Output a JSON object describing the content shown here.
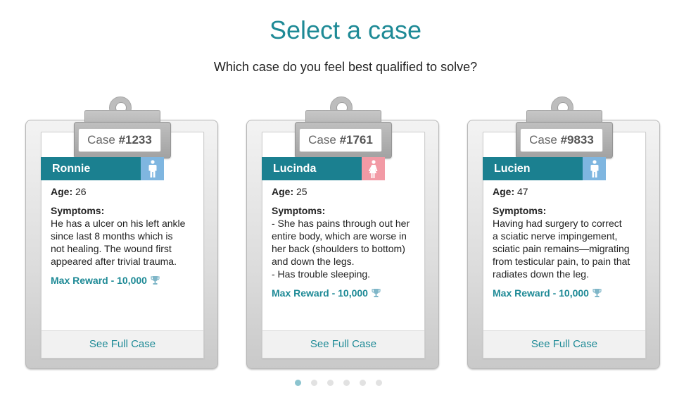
{
  "header": {
    "title": "Select a case",
    "subtitle": "Which case do you feel best qualified to solve?"
  },
  "cases": [
    {
      "case_prefix": "Case ",
      "case_number": "#1233",
      "name": "Ronnie",
      "gender": "male",
      "gender_icon": "male-person-icon",
      "age_label": "Age:",
      "age": "26",
      "symptoms_label": "Symptoms:",
      "symptom_lines": [
        "He has a ulcer on his left ankle",
        "since last 8 months which is",
        "not healing. The wound first",
        "appeared after trivial trauma."
      ],
      "reward": "Max Reward - 10,000",
      "reward_icon": "trophy-icon",
      "see_full": "See Full Case"
    },
    {
      "case_prefix": "Case ",
      "case_number": "#1761",
      "name": "Lucinda",
      "gender": "female",
      "gender_icon": "female-person-icon",
      "age_label": "Age:",
      "age": "25",
      "symptoms_label": "Symptoms:",
      "symptom_lines": [
        "- She has pains through out her",
        "entire body, which are worse in",
        "her back (shoulders to bottom)",
        "and down the legs.",
        "- Has trouble sleeping."
      ],
      "reward": "Max Reward - 10,000",
      "reward_icon": "trophy-icon",
      "see_full": "See Full Case"
    },
    {
      "case_prefix": "Case ",
      "case_number": "#9833",
      "name": "Lucien",
      "gender": "male",
      "gender_icon": "male-person-icon",
      "age_label": "Age:",
      "age": "47",
      "symptoms_label": "Symptoms:",
      "symptom_lines": [
        "Having had surgery to correct",
        "a sciatic nerve impingement,",
        "sciatic pain remains—migrating",
        "from testicular pain, to pain that",
        "radiates down the leg."
      ],
      "reward": "Max Reward - 10,000",
      "reward_icon": "trophy-icon",
      "see_full": "See Full Case"
    }
  ],
  "pagination": {
    "total": 6,
    "active": 1
  },
  "colors": {
    "accent": "#1e8a96",
    "name_bar": "#1b8090",
    "male": "#7fb6e0",
    "female": "#f29aa5",
    "trophy": "#7fb6c8"
  }
}
